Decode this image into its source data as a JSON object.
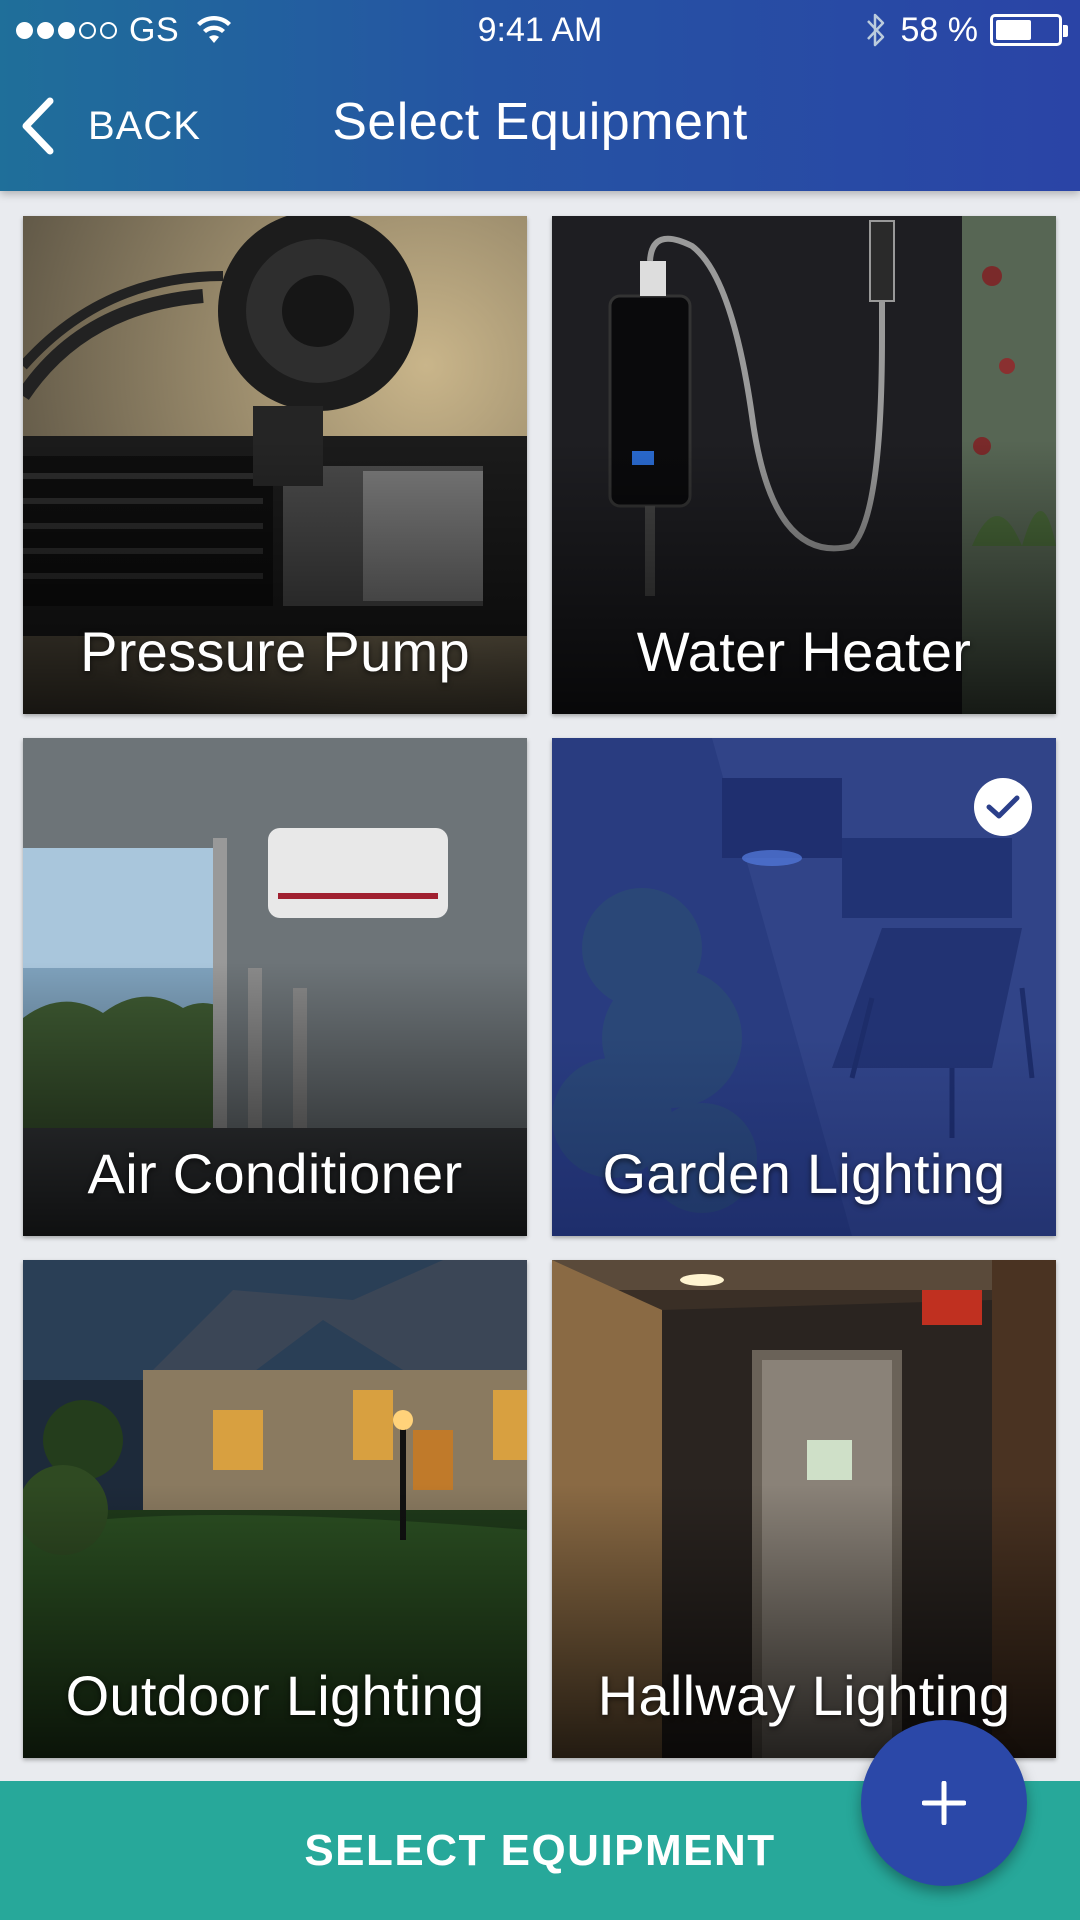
{
  "status_bar": {
    "carrier": "GS",
    "time": "9:41 AM",
    "battery_percent": "58 %",
    "battery_level": 0.58,
    "signal_bars_filled": 3,
    "signal_bars_total": 5,
    "icons": [
      "wifi-icon",
      "bluetooth-icon",
      "battery-icon"
    ]
  },
  "nav": {
    "back_label": "BACK",
    "title": "Select  Equipment",
    "back_icon": "chevron-left-icon"
  },
  "tiles": [
    {
      "label": "Pressure Pump",
      "selected": false
    },
    {
      "label": "Water Heater",
      "selected": false
    },
    {
      "label": "Air Conditioner",
      "selected": false
    },
    {
      "label": "Garden Lighting",
      "selected": true
    },
    {
      "label": "Outdoor Lighting",
      "selected": false
    },
    {
      "label": "Hallway Lighting",
      "selected": false
    }
  ],
  "bottom_bar": {
    "label": "SELECT  EQUIPMENT"
  },
  "fab": {
    "icon": "plus-icon"
  },
  "colors": {
    "header_start": "#1f6f9a",
    "header_end": "#2a44a6",
    "bottom_bar": "#27a89a",
    "fab": "#2b48a8",
    "selected_overlay": "#2846b4"
  }
}
